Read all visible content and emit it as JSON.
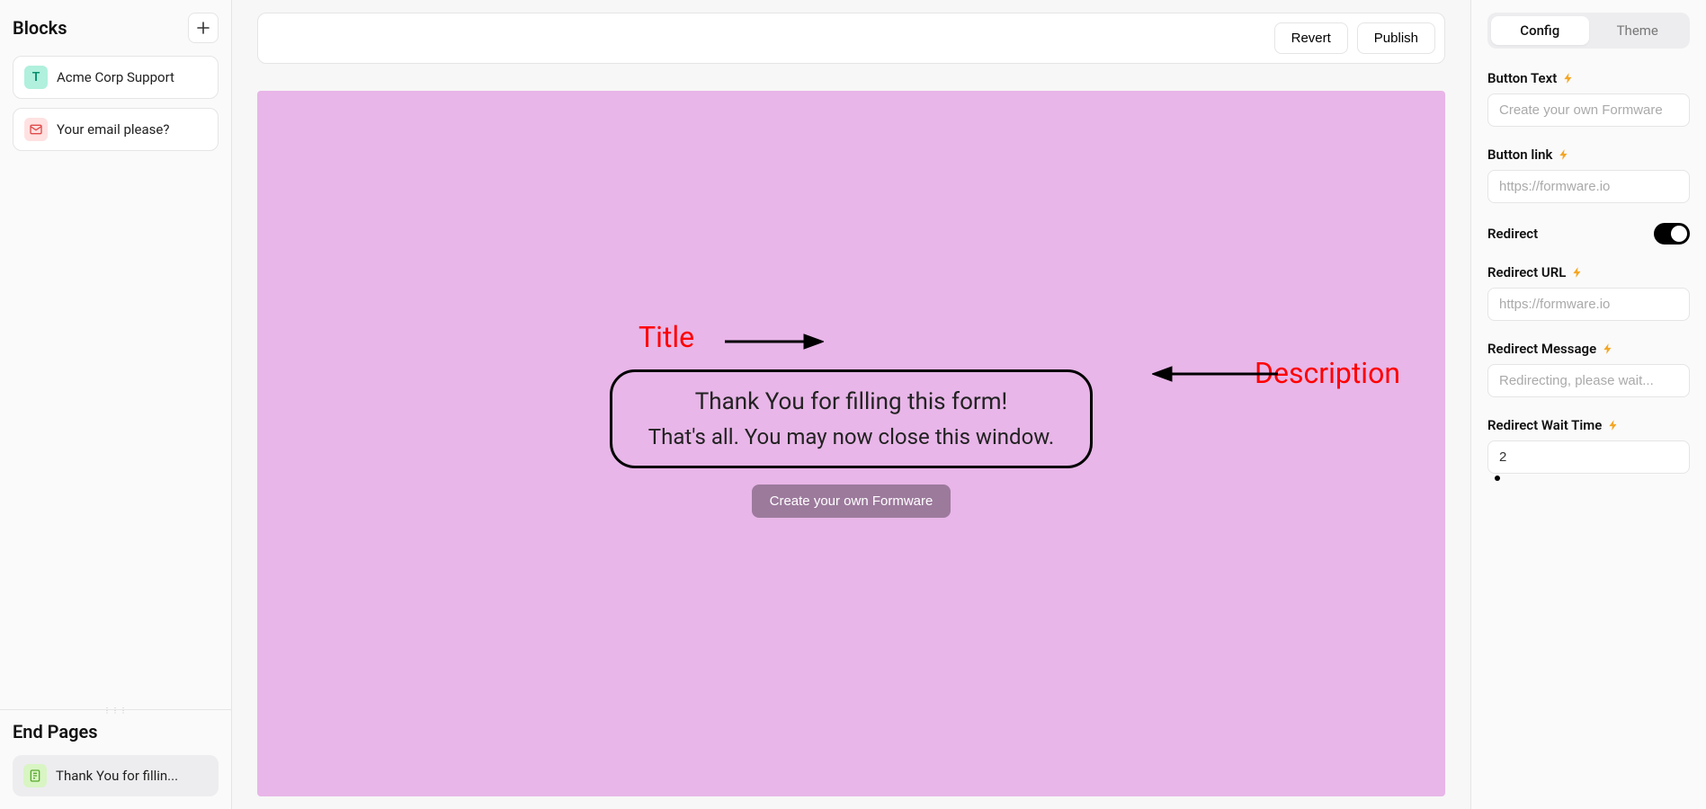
{
  "sidebar": {
    "blocks_title": "Blocks",
    "items": [
      {
        "label": "Acme Corp Support",
        "icon": "text-icon"
      },
      {
        "label": "Your email please?",
        "icon": "mail-icon"
      }
    ],
    "endpages_title": "End Pages",
    "endpage_items": [
      {
        "label": "Thank You for fillin...",
        "icon": "doc-icon"
      }
    ]
  },
  "toolbar": {
    "revert_label": "Revert",
    "publish_label": "Publish"
  },
  "canvas": {
    "title": "Thank You for filling this form!",
    "description": "That's all. You may now close this window.",
    "button_label": "Create your own Formware"
  },
  "annotations": {
    "title_label": "Title",
    "description_label": "Description"
  },
  "config": {
    "tab_config": "Config",
    "tab_theme": "Theme",
    "button_text_label": "Button Text",
    "button_text_placeholder": "Create your own Formware",
    "button_link_label": "Button link",
    "button_link_placeholder": "https://formware.io",
    "redirect_label": "Redirect",
    "redirect_url_label": "Redirect URL",
    "redirect_url_placeholder": "https://formware.io",
    "redirect_message_label": "Redirect Message",
    "redirect_message_placeholder": "Redirecting, please wait...",
    "redirect_wait_label": "Redirect Wait Time",
    "redirect_wait_value": "2"
  }
}
